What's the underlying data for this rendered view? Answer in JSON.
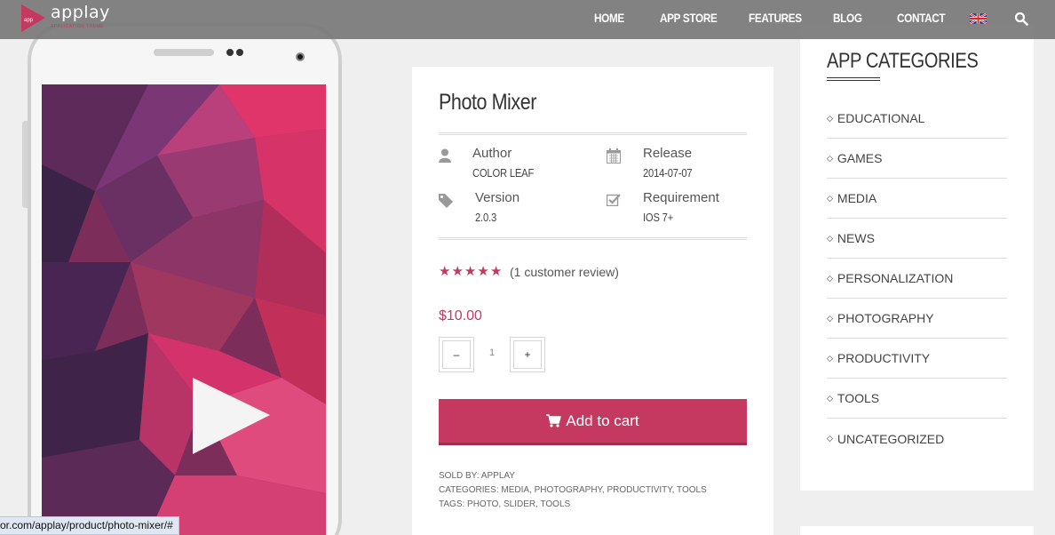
{
  "nav": {
    "logo_text": "applay",
    "logo_badge": "app",
    "logo_tagline": "APPLICATION THEME",
    "items": [
      {
        "label": "HOME"
      },
      {
        "label": "APP STORE"
      },
      {
        "label": "FEATURES"
      },
      {
        "label": "BLOG"
      },
      {
        "label": "CONTACT"
      }
    ],
    "flag_icon": "uk-flag-icon",
    "search_icon": "search-icon"
  },
  "phone": {
    "play_icon": "play-icon"
  },
  "product": {
    "title": "Photo Mixer",
    "author_label": "Author",
    "author_value": "COLOR LEAF",
    "release_label": "Release",
    "release_value": "2014-07-07",
    "version_label": "Version",
    "version_value": "2.0.3",
    "requirement_label": "Requirement",
    "requirement_value": "IOS 7+",
    "rating": 5,
    "rating_max": 5,
    "review_text": "(1 customer review)",
    "price": "$10.00",
    "qty_minus": "–",
    "qty_plus": "+",
    "qty_value": "1",
    "add_to_cart": "Add to cart",
    "sold_by": "SOLD BY: APPLAY",
    "categories": "CATEGORIES: MEDIA, PHOTOGRAPHY, PRODUCTIVITY, TOOLS",
    "tags": "TAGS: PHOTO, SLIDER, TOOLS"
  },
  "sidebar": {
    "title": "APP CATEGORIES",
    "items": [
      {
        "label": "EDUCATIONAL"
      },
      {
        "label": "GAMES"
      },
      {
        "label": "MEDIA"
      },
      {
        "label": "NEWS"
      },
      {
        "label": "PERSONALIZATION"
      },
      {
        "label": "PHOTOGRAPHY"
      },
      {
        "label": "PRODUCTIVITY"
      },
      {
        "label": "TOOLS"
      },
      {
        "label": "UNCATEGORIZED"
      }
    ]
  },
  "status_url": "or.com/applay/product/photo-mixer/#",
  "colors": {
    "accent": "#c5385f",
    "topbar": "#787878",
    "background": "#efefef"
  }
}
